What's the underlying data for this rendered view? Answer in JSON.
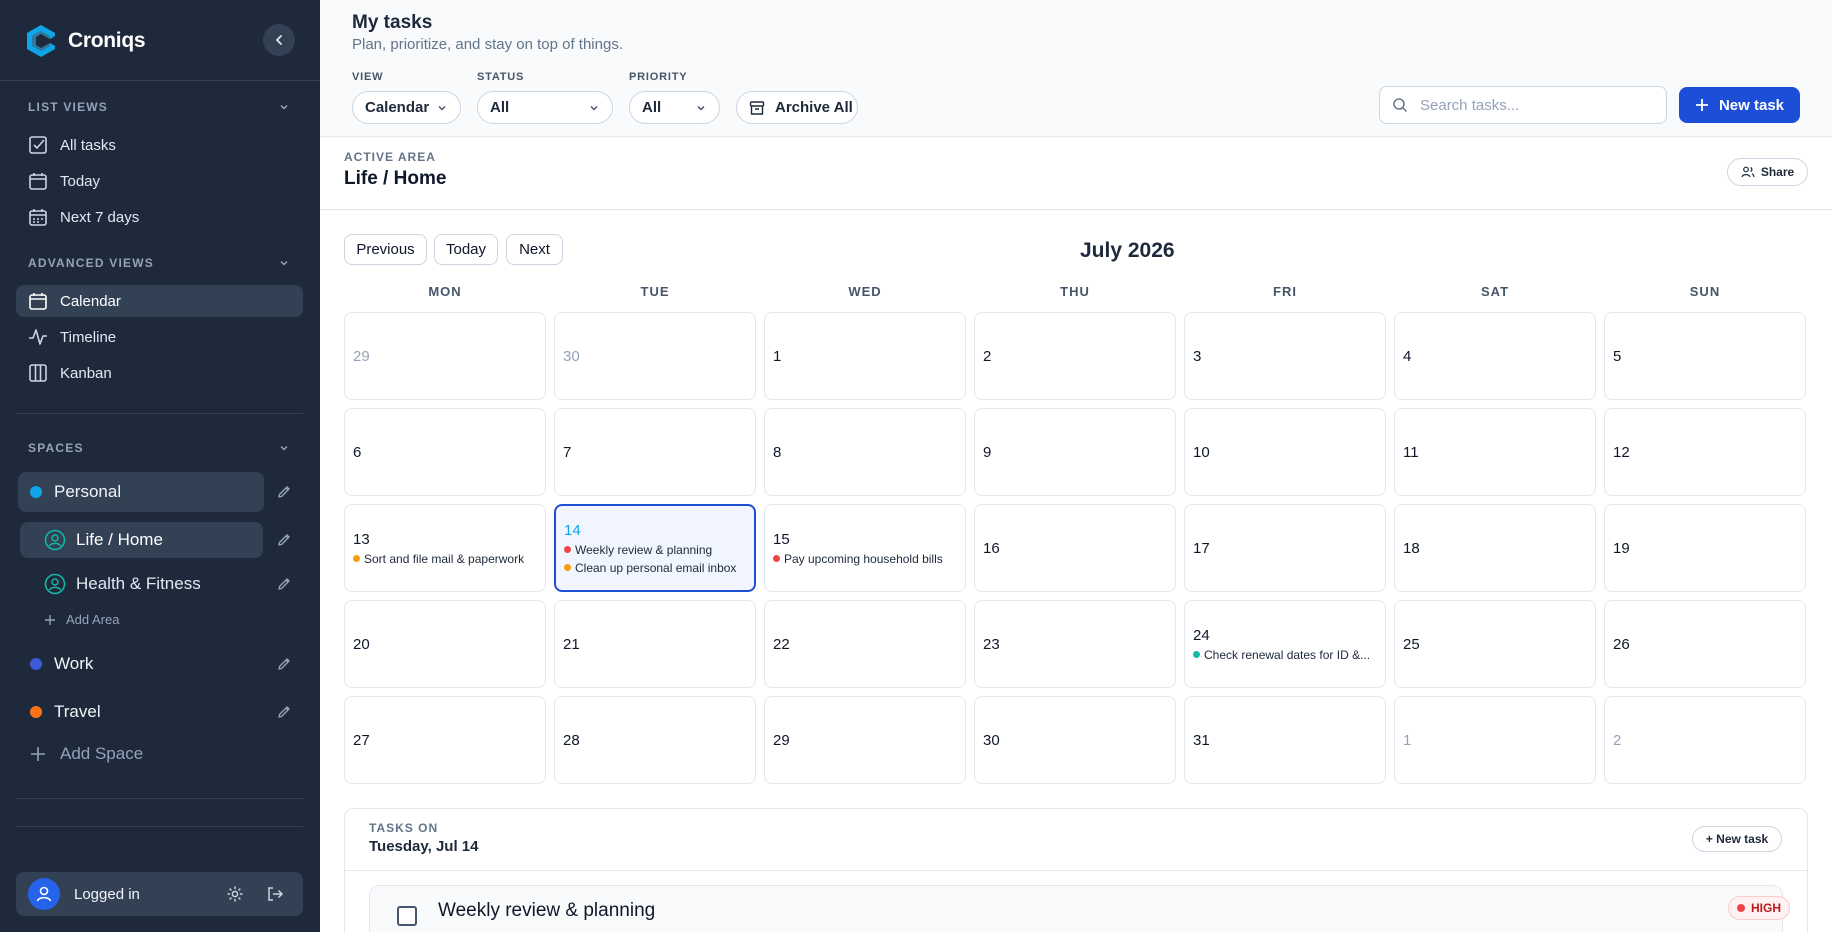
{
  "app": {
    "name": "Croniqs"
  },
  "colors": {
    "sidebar_bg": "#1e293b",
    "accent": "#1d4ed8",
    "high": "#ef4444",
    "medium": "#f59e0b",
    "low": "#14b8a6"
  },
  "sidebar": {
    "list_views": {
      "title": "LIST VIEWS",
      "items": [
        {
          "label": "All tasks",
          "icon": "checkbox-icon"
        },
        {
          "label": "Today",
          "icon": "calendar-icon"
        },
        {
          "label": "Next 7 days",
          "icon": "calendar-week-icon"
        }
      ]
    },
    "advanced_views": {
      "title": "ADVANCED VIEWS",
      "items": [
        {
          "label": "Calendar",
          "icon": "calendar-icon",
          "active": true
        },
        {
          "label": "Timeline",
          "icon": "pulse-icon"
        },
        {
          "label": "Kanban",
          "icon": "columns-icon"
        }
      ]
    },
    "spaces": {
      "title": "SPACES",
      "items": [
        {
          "label": "Personal",
          "color": "#0ea5e9"
        },
        {
          "label": "Work",
          "color": "#3b5bdb"
        },
        {
          "label": "Travel",
          "color": "#f97316"
        }
      ],
      "areas": [
        {
          "label": "Life / Home",
          "active": true
        },
        {
          "label": "Health & Fitness"
        }
      ],
      "add_area": "Add Area",
      "add_space": "Add Space"
    },
    "user": {
      "label": "Logged in"
    }
  },
  "header": {
    "title": "My tasks",
    "subtitle": "Plan, prioritize, and stay on top of things.",
    "view": {
      "label": "VIEW",
      "value": "Calendar"
    },
    "status": {
      "label": "STATUS",
      "value": "All"
    },
    "priority": {
      "label": "PRIORITY",
      "value": "All"
    },
    "archive_label": "Archive All",
    "search_placeholder": "Search tasks...",
    "new_task_label": "New task"
  },
  "area": {
    "kicker": "ACTIVE AREA",
    "title": "Life / Home",
    "share_label": "Share"
  },
  "calendar": {
    "prev_label": "Previous",
    "today_label": "Today",
    "next_label": "Next",
    "month": "July 2026",
    "weekdays": [
      "MON",
      "TUE",
      "WED",
      "THU",
      "FRI",
      "SAT",
      "SUN"
    ],
    "weeks": [
      [
        {
          "n": "29",
          "muted": true
        },
        {
          "n": "30",
          "muted": true
        },
        {
          "n": "1"
        },
        {
          "n": "2"
        },
        {
          "n": "3"
        },
        {
          "n": "4"
        },
        {
          "n": "5"
        }
      ],
      [
        {
          "n": "6"
        },
        {
          "n": "7"
        },
        {
          "n": "8"
        },
        {
          "n": "9"
        },
        {
          "n": "10"
        },
        {
          "n": "11"
        },
        {
          "n": "12"
        }
      ],
      [
        {
          "n": "13",
          "events": [
            {
              "title": "Sort and file mail & paperwork",
              "color": "#f59e0b"
            }
          ]
        },
        {
          "n": "14",
          "selected": true,
          "events": [
            {
              "title": "Weekly review & planning",
              "color": "#ef4444"
            },
            {
              "title": "Clean up personal email inbox",
              "color": "#f59e0b"
            }
          ]
        },
        {
          "n": "15",
          "events": [
            {
              "title": "Pay upcoming household bills",
              "color": "#ef4444"
            }
          ]
        },
        {
          "n": "16"
        },
        {
          "n": "17"
        },
        {
          "n": "18"
        },
        {
          "n": "19"
        }
      ],
      [
        {
          "n": "20"
        },
        {
          "n": "21"
        },
        {
          "n": "22"
        },
        {
          "n": "23"
        },
        {
          "n": "24",
          "events": [
            {
              "title": "Check renewal dates for ID &...",
              "color": "#14b8a6"
            }
          ]
        },
        {
          "n": "25"
        },
        {
          "n": "26"
        }
      ],
      [
        {
          "n": "27"
        },
        {
          "n": "28"
        },
        {
          "n": "29"
        },
        {
          "n": "30"
        },
        {
          "n": "31"
        },
        {
          "n": "1",
          "muted": true
        },
        {
          "n": "2",
          "muted": true
        }
      ]
    ]
  },
  "tasks_panel": {
    "kicker": "TASKS ON",
    "date": "Tuesday, Jul 14",
    "new_label": "+ New task",
    "tasks": [
      {
        "title": "Weekly review & planning",
        "priority": "HIGH"
      }
    ]
  }
}
